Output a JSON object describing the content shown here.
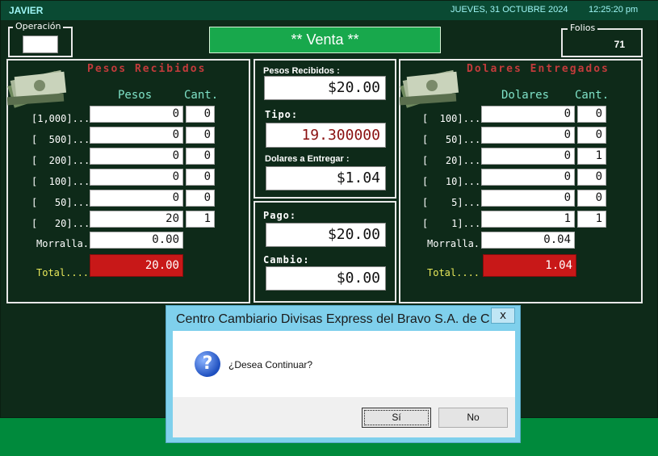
{
  "header": {
    "user": "JAVIER",
    "date": "JUEVES, 31  OCTUBRE 2024",
    "time": "12:25:20 pm"
  },
  "operacion": {
    "label": "Operación",
    "value": ""
  },
  "mode_button": "** Venta **",
  "folios": {
    "label": "Folios",
    "value": "71"
  },
  "pesos_panel": {
    "title": "Pesos Recibidos",
    "col_pesos": "Pesos",
    "col_cant": "Cant.",
    "rows": [
      {
        "label": "[1,000]...",
        "pesos": "0",
        "cant": "0"
      },
      {
        "label": "[  500]...",
        "pesos": "0",
        "cant": "0"
      },
      {
        "label": "[  200]...",
        "pesos": "0",
        "cant": "0"
      },
      {
        "label": "[  100]...",
        "pesos": "0",
        "cant": "0"
      },
      {
        "label": "[   50]...",
        "pesos": "0",
        "cant": "0"
      },
      {
        "label": "[   20]...",
        "pesos": "20",
        "cant": "1"
      }
    ],
    "morralla_label": "Morralla.",
    "morralla_value": "0.00",
    "total_label": "Total....",
    "total_value": "20.00"
  },
  "middle": {
    "pesos_recibidos_label": "Pesos Recibidos :",
    "pesos_recibidos_value": "$20.00",
    "tipo_label": "Tipo:",
    "tipo_value": "19.300000",
    "dolares_label": "Dolares a Entregar :",
    "dolares_value": "$1.04",
    "pago_label": "Pago:",
    "pago_value": "$20.00",
    "cambio_label": "Cambio:",
    "cambio_value": "$0.00"
  },
  "dolares_panel": {
    "title": "Dolares Entregados",
    "col_dolares": "Dolares",
    "col_cant": "Cant.",
    "rows": [
      {
        "label": "[  100]...",
        "dolares": "0",
        "cant": "0"
      },
      {
        "label": "[   50]...",
        "dolares": "0",
        "cant": "0"
      },
      {
        "label": "[   20]...",
        "dolares": "0",
        "cant": "1"
      },
      {
        "label": "[   10]...",
        "dolares": "0",
        "cant": "0"
      },
      {
        "label": "[    5]...",
        "dolares": "0",
        "cant": "0"
      },
      {
        "label": "[    1]...",
        "dolares": "1",
        "cant": "1"
      }
    ],
    "morralla_label": "Morralla.",
    "morralla_value": "0.04",
    "total_label": "Total....",
    "total_value": "1.04"
  },
  "dialog": {
    "title": "Centro Cambiario Divisas Express del Bravo S.A. de C.V.",
    "close": "x",
    "message": "¿Desea Continuar?",
    "yes": "Sí",
    "no": "No"
  },
  "colors": {
    "background": "#0e2a19",
    "accent_green": "#18a84c",
    "total_red": "#c81818",
    "panel_title_red": "#c23b3b",
    "dialog_frame": "#7fd0ec"
  }
}
